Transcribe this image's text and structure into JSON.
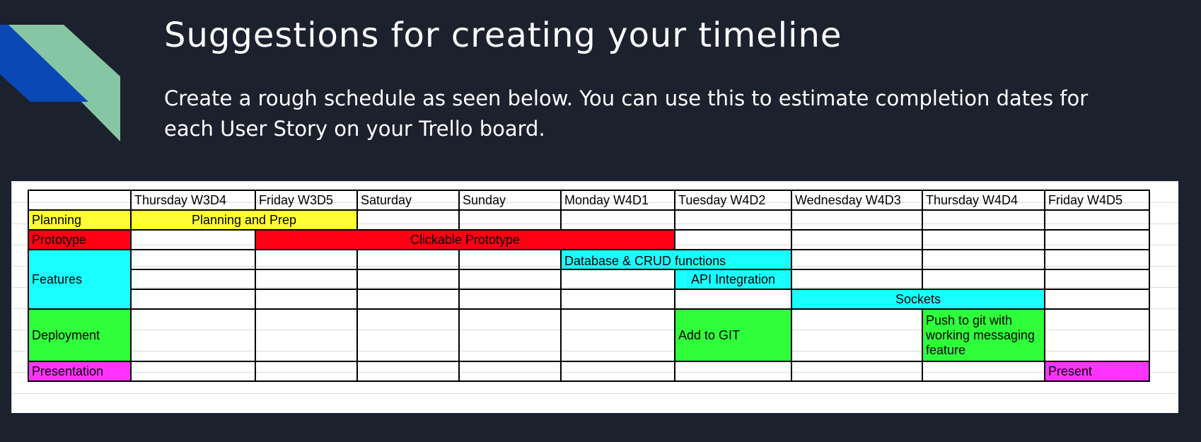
{
  "slide": {
    "title": "Suggestions for creating your timeline",
    "subtitle": "Create a rough schedule as seen below. You can use this to estimate completion dates for each User Story on your Trello board."
  },
  "colors": {
    "background": "#1c212e",
    "logo_blue": "#0a48b5",
    "logo_green": "#86c6a5",
    "planning": "#ffff33",
    "prototype": "#ff0013",
    "features": "#19ffff",
    "deployment": "#2fff3a",
    "presentation": "#ff33ff"
  },
  "timeline": {
    "days": [
      "Thursday W3D4",
      "Friday W3D5",
      "Saturday",
      "Sunday",
      "Monday W4D1",
      "Tuesday W4D2",
      "Wednesday W4D3",
      "Thursday W4D4",
      "Friday W4D5"
    ],
    "categories": {
      "planning": "Planning",
      "prototype": "Prototype",
      "features": "Features",
      "deployment": "Deployment",
      "presentation": "Presentation"
    },
    "tasks": {
      "planning_prep": "Planning and Prep",
      "clickable_prototype": "Clickable Prototype",
      "database_crud": "Database & CRUD functions",
      "api_integration": "API Integration",
      "sockets": "Sockets",
      "add_to_git": "Add to GIT",
      "push_to_git": "Push to git with working messaging feature",
      "present": "Present"
    }
  }
}
